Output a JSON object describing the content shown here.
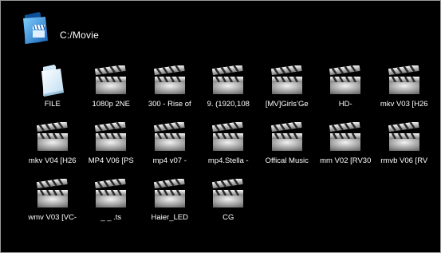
{
  "header": {
    "path": "C:/Movie",
    "icon": "video-folder-icon"
  },
  "colors": {
    "background": "#000000",
    "text": "#ffffff",
    "folder_light": "#e9f6ff",
    "folder_shadow": "#8fb8d4"
  },
  "items": [
    {
      "label": "FILE",
      "type": "folder",
      "icon": "folder-icon"
    },
    {
      "label": "1080p   2NE",
      "type": "video",
      "icon": "clapperboard-icon"
    },
    {
      "label": "300 - Rise of",
      "type": "video",
      "icon": "clapperboard-icon"
    },
    {
      "label": "9.  (1920,108",
      "type": "video",
      "icon": "clapperboard-icon"
    },
    {
      "label": "[MV]Girls’Ge",
      "type": "video",
      "icon": "clapperboard-icon"
    },
    {
      "label": "HD-",
      "type": "video",
      "icon": "clapperboard-icon"
    },
    {
      "label": "mkv V03 [H26",
      "type": "video",
      "icon": "clapperboard-icon"
    },
    {
      "label": "mkv V04 [H26",
      "type": "video",
      "icon": "clapperboard-icon"
    },
    {
      "label": "MP4 V06 [PS",
      "type": "video",
      "icon": "clapperboard-icon"
    },
    {
      "label": "mp4 v07   -",
      "type": "video",
      "icon": "clapperboard-icon"
    },
    {
      "label": "mp4.Stella -",
      "type": "video",
      "icon": "clapperboard-icon"
    },
    {
      "label": "Offical Music",
      "type": "video",
      "icon": "clapperboard-icon"
    },
    {
      "label": "mm V02 [RV30",
      "type": "video",
      "icon": "clapperboard-icon"
    },
    {
      "label": "rmvb V06 [RV",
      "type": "video",
      "icon": "clapperboard-icon"
    },
    {
      "label": "wmv V03 [VC-",
      "type": "video",
      "icon": "clapperboard-icon"
    },
    {
      "label": "_ _ .ts",
      "type": "video",
      "icon": "clapperboard-icon"
    },
    {
      "label": "Haier_LED",
      "type": "video",
      "icon": "clapperboard-icon"
    },
    {
      "label": "CG",
      "type": "video",
      "icon": "clapperboard-icon"
    }
  ]
}
